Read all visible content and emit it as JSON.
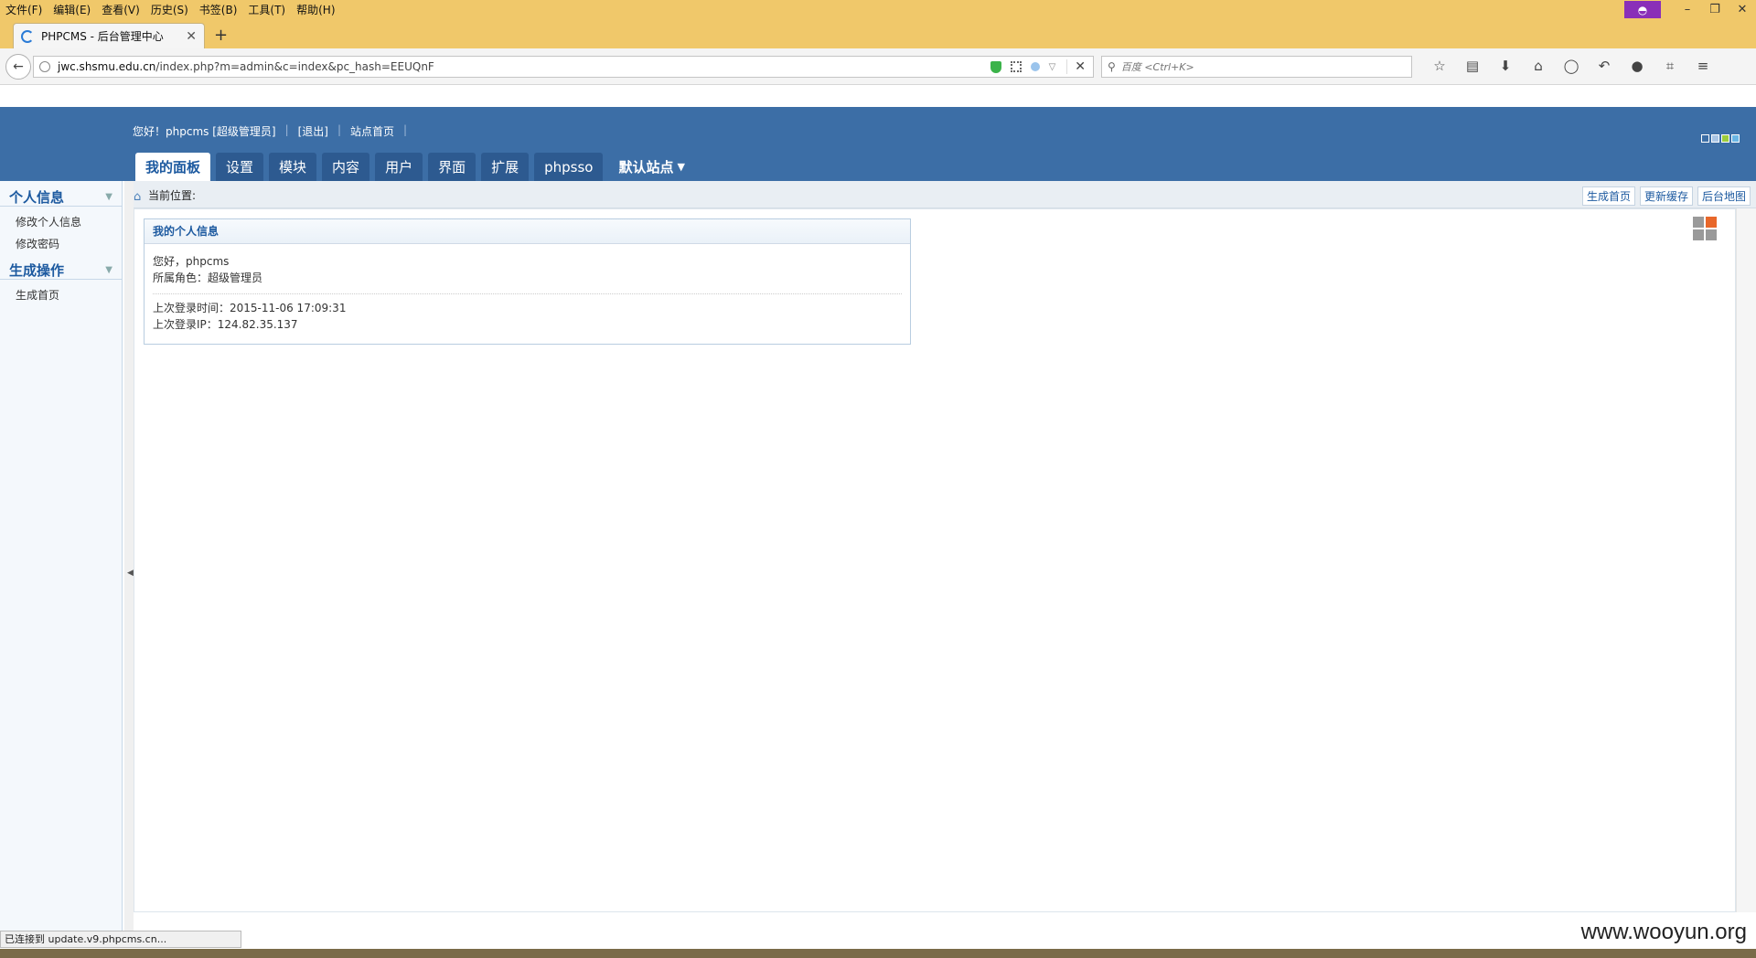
{
  "browser": {
    "menu": [
      "文件(F)",
      "编辑(E)",
      "查看(V)",
      "历史(S)",
      "书签(B)",
      "工具(T)",
      "帮助(H)"
    ],
    "tab_title": "PHPCMS - 后台管理中心",
    "url_host": "jwc.shsmu.edu.cn",
    "url_path": "/index.php?m=admin&c=index&pc_hash=EEUQnF",
    "search_placeholder": "百度 <Ctrl+K>",
    "status_text": "已连接到 update.v9.phpcms.cn..."
  },
  "header": {
    "greeting": "您好！phpcms [超级管理员]",
    "logout": "[退出]",
    "site_home": "站点首页",
    "tabs": [
      "我的面板",
      "设置",
      "模块",
      "内容",
      "用户",
      "界面",
      "扩展",
      "phpsso"
    ],
    "site_selector": "默认站点"
  },
  "sidebar": {
    "groups": [
      {
        "title": "个人信息",
        "items": [
          "修改个人信息",
          "修改密码"
        ]
      },
      {
        "title": "生成操作",
        "items": [
          "生成首页"
        ]
      }
    ]
  },
  "breadcrumb": {
    "label": "当前位置:"
  },
  "quick_buttons": [
    "生成首页",
    "更新缓存",
    "后台地图"
  ],
  "info_box": {
    "title": "我的个人信息",
    "hello": "您好，phpcms",
    "role": "所属角色：超级管理员",
    "last_login_time": "上次登录时间：2015-11-06 17:09:31",
    "last_login_ip": "上次登录IP：124.82.35.137"
  },
  "watermark": "www.wooyun.org"
}
